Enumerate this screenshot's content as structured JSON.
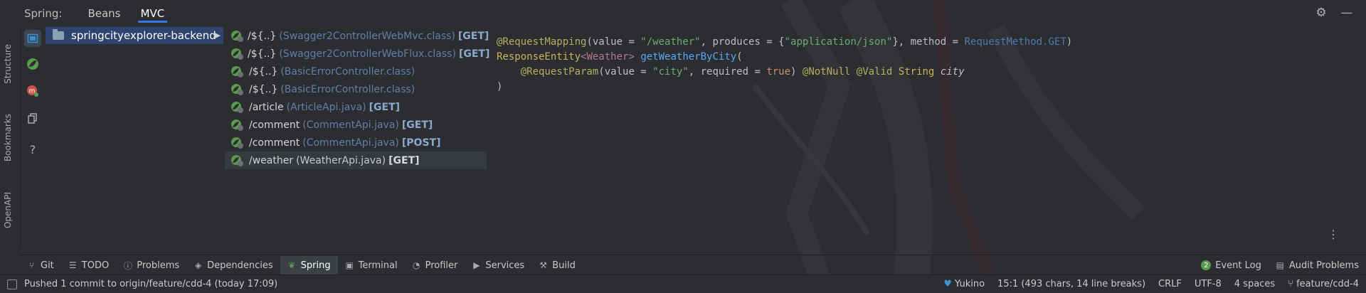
{
  "header": {
    "title": "Spring:",
    "tabs": [
      {
        "label": "Beans",
        "active": false
      },
      {
        "label": "MVC",
        "active": true
      }
    ]
  },
  "left_strip": {
    "labels": [
      "Structure",
      "Bookmarks",
      "OpenAPI"
    ]
  },
  "project": {
    "name": "springcityexplorer-backend"
  },
  "mappings": [
    {
      "path": "/${..}",
      "controller": "(Swagger2ControllerWebMvc.class)",
      "method": "[GET]"
    },
    {
      "path": "/${..}",
      "controller": "(Swagger2ControllerWebFlux.class)",
      "method": "[GET]"
    },
    {
      "path": "/${..}",
      "controller": "(BasicErrorController.class)",
      "method": ""
    },
    {
      "path": "/${..}",
      "controller": "(BasicErrorController.class)",
      "method": ""
    },
    {
      "path": "/article",
      "controller": "(ArticleApi.java)",
      "method": "[GET]"
    },
    {
      "path": "/comment",
      "controller": "(CommentApi.java)",
      "method": "[GET]"
    },
    {
      "path": "/comment",
      "controller": "(CommentApi.java)",
      "method": "[POST]"
    },
    {
      "path": "/weather",
      "controller": "(WeatherApi.java)",
      "method": "[GET]",
      "selected": true
    }
  ],
  "code": {
    "l1_annotation": "@RequestMapping",
    "l1_a": "(value = ",
    "l1_value": "\"/weather\"",
    "l1_b": ", produces = {",
    "l1_produces": "\"application/json\"",
    "l1_c": "}, method = ",
    "l1_enum": "RequestMethod.GET",
    "l1_d": ")",
    "l2_type": "ResponseEntity",
    "l2_generic": "<Weather>",
    "l2_method": "getWeatherByCity",
    "l2_paren": "(",
    "l3_annotation": "@RequestParam",
    "l3_a": "(value = ",
    "l3_value": "\"city\"",
    "l3_b": ", required = ",
    "l3_true": "true",
    "l3_c": ") ",
    "l3_notnull": "@NotNull",
    "l3_valid": "@Valid",
    "l3_type": "String",
    "l3_param": "city",
    "l4": ")"
  },
  "toolwindows": [
    {
      "label": "Git",
      "icon": "git-branch-icon"
    },
    {
      "label": "TODO",
      "icon": "list-icon"
    },
    {
      "label": "Problems",
      "icon": "info-icon"
    },
    {
      "label": "Dependencies",
      "icon": "layers-icon"
    },
    {
      "label": "Spring",
      "icon": "spring-leaf-icon",
      "active": true
    },
    {
      "label": "Terminal",
      "icon": "terminal-icon"
    },
    {
      "label": "Profiler",
      "icon": "profiler-icon"
    },
    {
      "label": "Services",
      "icon": "play-icon"
    },
    {
      "label": "Build",
      "icon": "hammer-icon"
    }
  ],
  "toolwindows_right": [
    {
      "label": "Event Log",
      "badge": "2"
    },
    {
      "label": "Audit Problems"
    }
  ],
  "status": {
    "message": "Pushed 1 commit to origin/feature/cdd-4 (today 17:09)",
    "user": "Yukino",
    "position": "15:1 (493 chars, 14 line breaks)",
    "line_sep": "CRLF",
    "encoding": "UTF-8",
    "indent": "4 spaces",
    "branch": "feature/cdd-4"
  },
  "colors": {
    "accent": "#3574f0",
    "spring_green": "#5a9b4f",
    "selection": "#2e436e"
  }
}
